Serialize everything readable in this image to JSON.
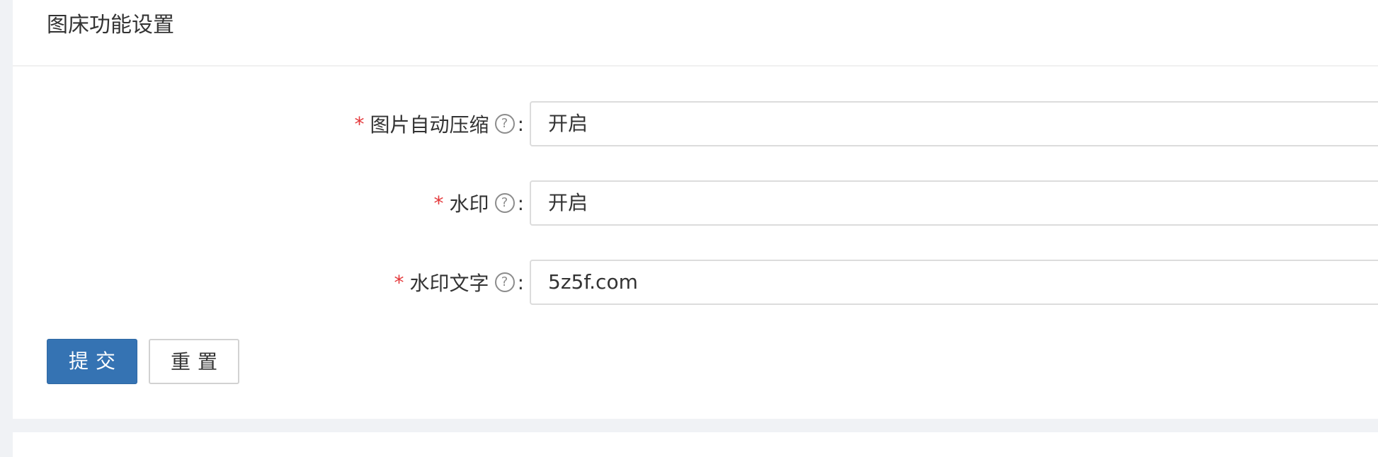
{
  "card": {
    "title": "图床功能设置"
  },
  "form": {
    "fields": [
      {
        "required_mark": "*",
        "label": "图片自动压缩",
        "help_icon": "?",
        "colon": ":",
        "value": "开启"
      },
      {
        "required_mark": "*",
        "label": "水印",
        "help_icon": "?",
        "colon": ":",
        "value": "开启"
      },
      {
        "required_mark": "*",
        "label": "水印文字",
        "help_icon": "?",
        "colon": ":",
        "value": "5z5f.com"
      }
    ],
    "submit_label": "提交",
    "reset_label": "重置"
  },
  "colors": {
    "primary": "#3573b3",
    "required": "#e4393c",
    "background": "#f0f2f5"
  },
  "icons": {
    "help": "question-circle-icon"
  }
}
